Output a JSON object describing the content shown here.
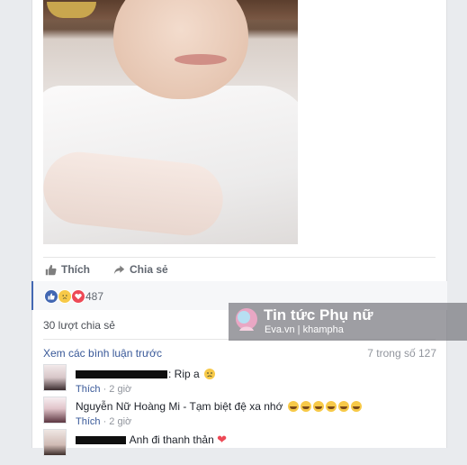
{
  "actions": {
    "like_label": "Thích",
    "share_label": "Chia sẻ"
  },
  "reactions": {
    "icons": [
      "like-icon",
      "sad-icon",
      "love-icon"
    ],
    "count": "487"
  },
  "shares_text": "30 lượt chia sẻ",
  "comments_header": {
    "view_previous": "Xem các bình luận trước",
    "pager": "7 trong số 127"
  },
  "comments": [
    {
      "text": ": Rip a",
      "emoji": "sad-face-emoji",
      "like": "Thích",
      "time": "· 2 giờ"
    },
    {
      "text": "Nguyễn Nữ Hoàng Mi - Tạm biệt đệ xa nhớ",
      "emoji_count": 6,
      "like": "Thích",
      "time": "· 2 giờ"
    },
    {
      "text": "Anh đi thanh thản",
      "emoji": "heart-emoji"
    }
  ],
  "watermark": {
    "title": "Tin tức Phụ nữ",
    "subtitle": "Eva.vn  |  khampha"
  },
  "colors": {
    "accent": "#4267b2",
    "link": "#385898",
    "meta": "#90949c"
  }
}
